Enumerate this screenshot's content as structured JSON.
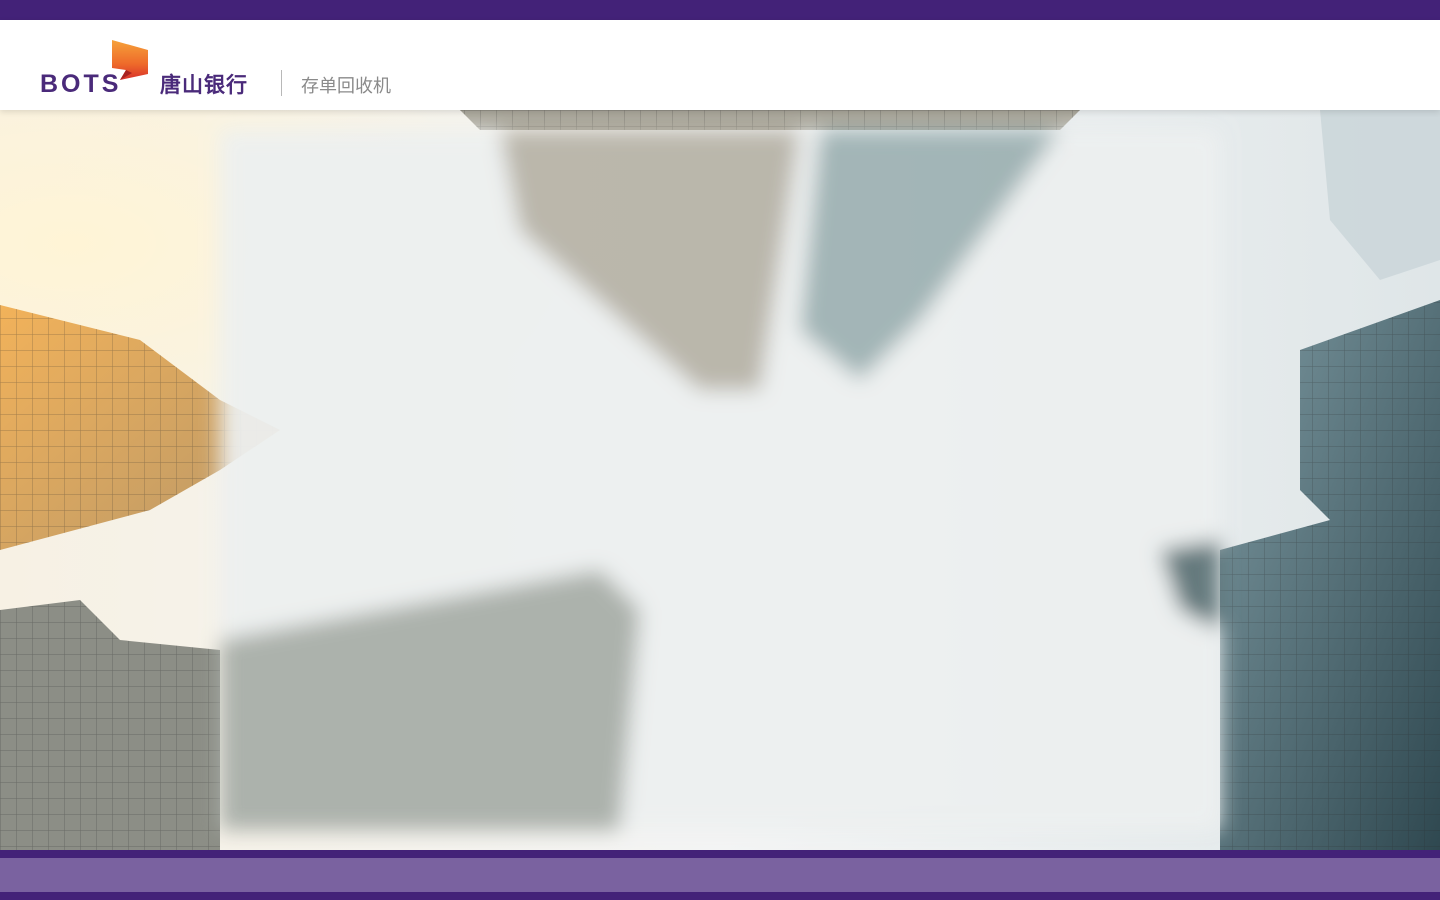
{
  "brand": {
    "latin_name": "BOTS",
    "chinese_name": "唐山银行",
    "subtitle": "存单回收机",
    "logo_icon": "ribbon-flag-icon"
  },
  "colors": {
    "top_bar": "#432278",
    "brand_text": "#4a2a7a",
    "logo_accent_top": "#f28c28",
    "logo_accent_bottom": "#e0352b",
    "subtitle_text": "#8a8a8a",
    "bottom_band_outer": "#432278",
    "bottom_band_inner": "#7a62a0"
  },
  "hero": {
    "image_alt": "",
    "center_panel": "blurred-overlay"
  }
}
